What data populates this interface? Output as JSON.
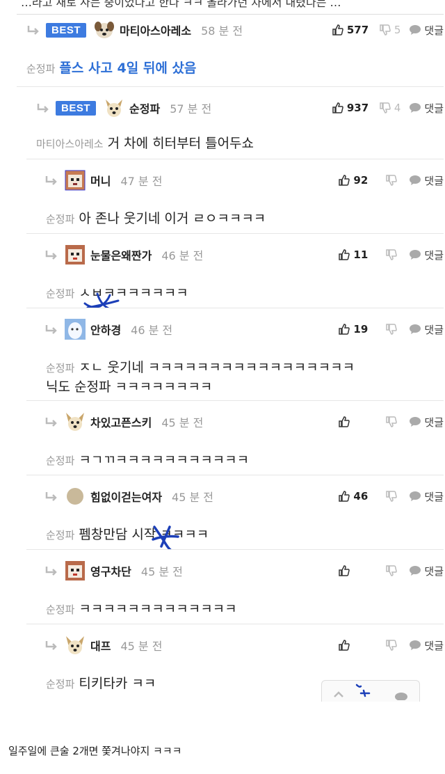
{
  "top_cut_text": "…라고 새로 사는 중이었다고 한다 ㅋㅋ 올라가던 차에서 내렸다는 …",
  "comments": [
    {
      "best": true,
      "best_label": "BEST",
      "nick": "마티아스아레소",
      "time": "58 분 전",
      "likes": "577",
      "dislikes": "5",
      "reply_label": "댓글",
      "mention": "순정파",
      "text": "플스 사고 4일 뒤에 샀음",
      "avatar": "dog-avatar"
    },
    {
      "best": true,
      "best_label": "BEST",
      "nick": "순정파",
      "time": "57 분 전",
      "likes": "937",
      "dislikes": "4",
      "reply_label": "댓글",
      "mention": "마티아스아레소",
      "text": "거 차에 히터부터 틀어두쇼",
      "avatar": "dog-avatar"
    },
    {
      "nick": "머니",
      "time": "47 분 전",
      "likes": "92",
      "dislikes": "",
      "reply_label": "댓글",
      "mention": "순정파",
      "text": "아 존나 웃기네 이거 ㄹㅇㅋㅋㅋㅋ",
      "avatar": "pixel-avatar"
    },
    {
      "nick": "눈물은왜짠가",
      "time": "46 분 전",
      "likes": "11",
      "dislikes": "",
      "reply_label": "댓글",
      "mention": "순정파",
      "text": "ㅅㅂㅋㅋㅋㅋㅋㅋㅋ",
      "avatar": "pixel-avatar"
    },
    {
      "nick": "안하경",
      "time": "46 분 전",
      "likes": "19",
      "dislikes": "",
      "reply_label": "댓글",
      "mention": "순정파",
      "text": "ㅈㄴ 웃기네 ㅋㅋㅋㅋㅋㅋㅋㅋㅋㅋㅋㅋㅋㅋㅋㅋㅋ",
      "text2": "닉도 순정파 ㅋㅋㅋㅋㅋㅋㅋㅋ",
      "avatar": "ghost-avatar"
    },
    {
      "nick": "차있고픈스키",
      "time": "45 분 전",
      "likes": "",
      "dislikes": "",
      "reply_label": "댓글",
      "mention": "순정파",
      "text": "ㅋㄱㄲㅋㅋㅋㅋㅋㅋㅋㅋㅋㅋㅋ",
      "avatar": "dog-avatar"
    },
    {
      "nick": "힘없이걷는여자",
      "time": "45 분 전",
      "likes": "46",
      "dislikes": "",
      "reply_label": "댓글",
      "mention": "순정파",
      "text": "펨창만담 시작 ㅋㅋㅋㅋ",
      "avatar": "circle-avatar"
    },
    {
      "nick": "영구차단",
      "time": "45 분 전",
      "likes": "",
      "dislikes": "",
      "reply_label": "댓글",
      "mention": "순정파",
      "text": "ㅋㅋㅋㅋㅋㅋㅋㅋㅋㅋㅋㅋㅋ",
      "avatar": "pixel-avatar"
    },
    {
      "nick": "대프",
      "time": "45 분 전",
      "likes": "",
      "dislikes": "",
      "reply_label": "댓글",
      "mention": "순정파",
      "text": "티키타카 ㅋㅋ",
      "avatar": "dog-avatar"
    }
  ],
  "footer_text": "일주일에 큰술 2개면 쫓겨나야지 ㅋㅋㅋ",
  "colors": {
    "best_badge": "#3d7be0",
    "scribble": "#1c3fb8",
    "mention_blue": "#2d6fd6"
  }
}
